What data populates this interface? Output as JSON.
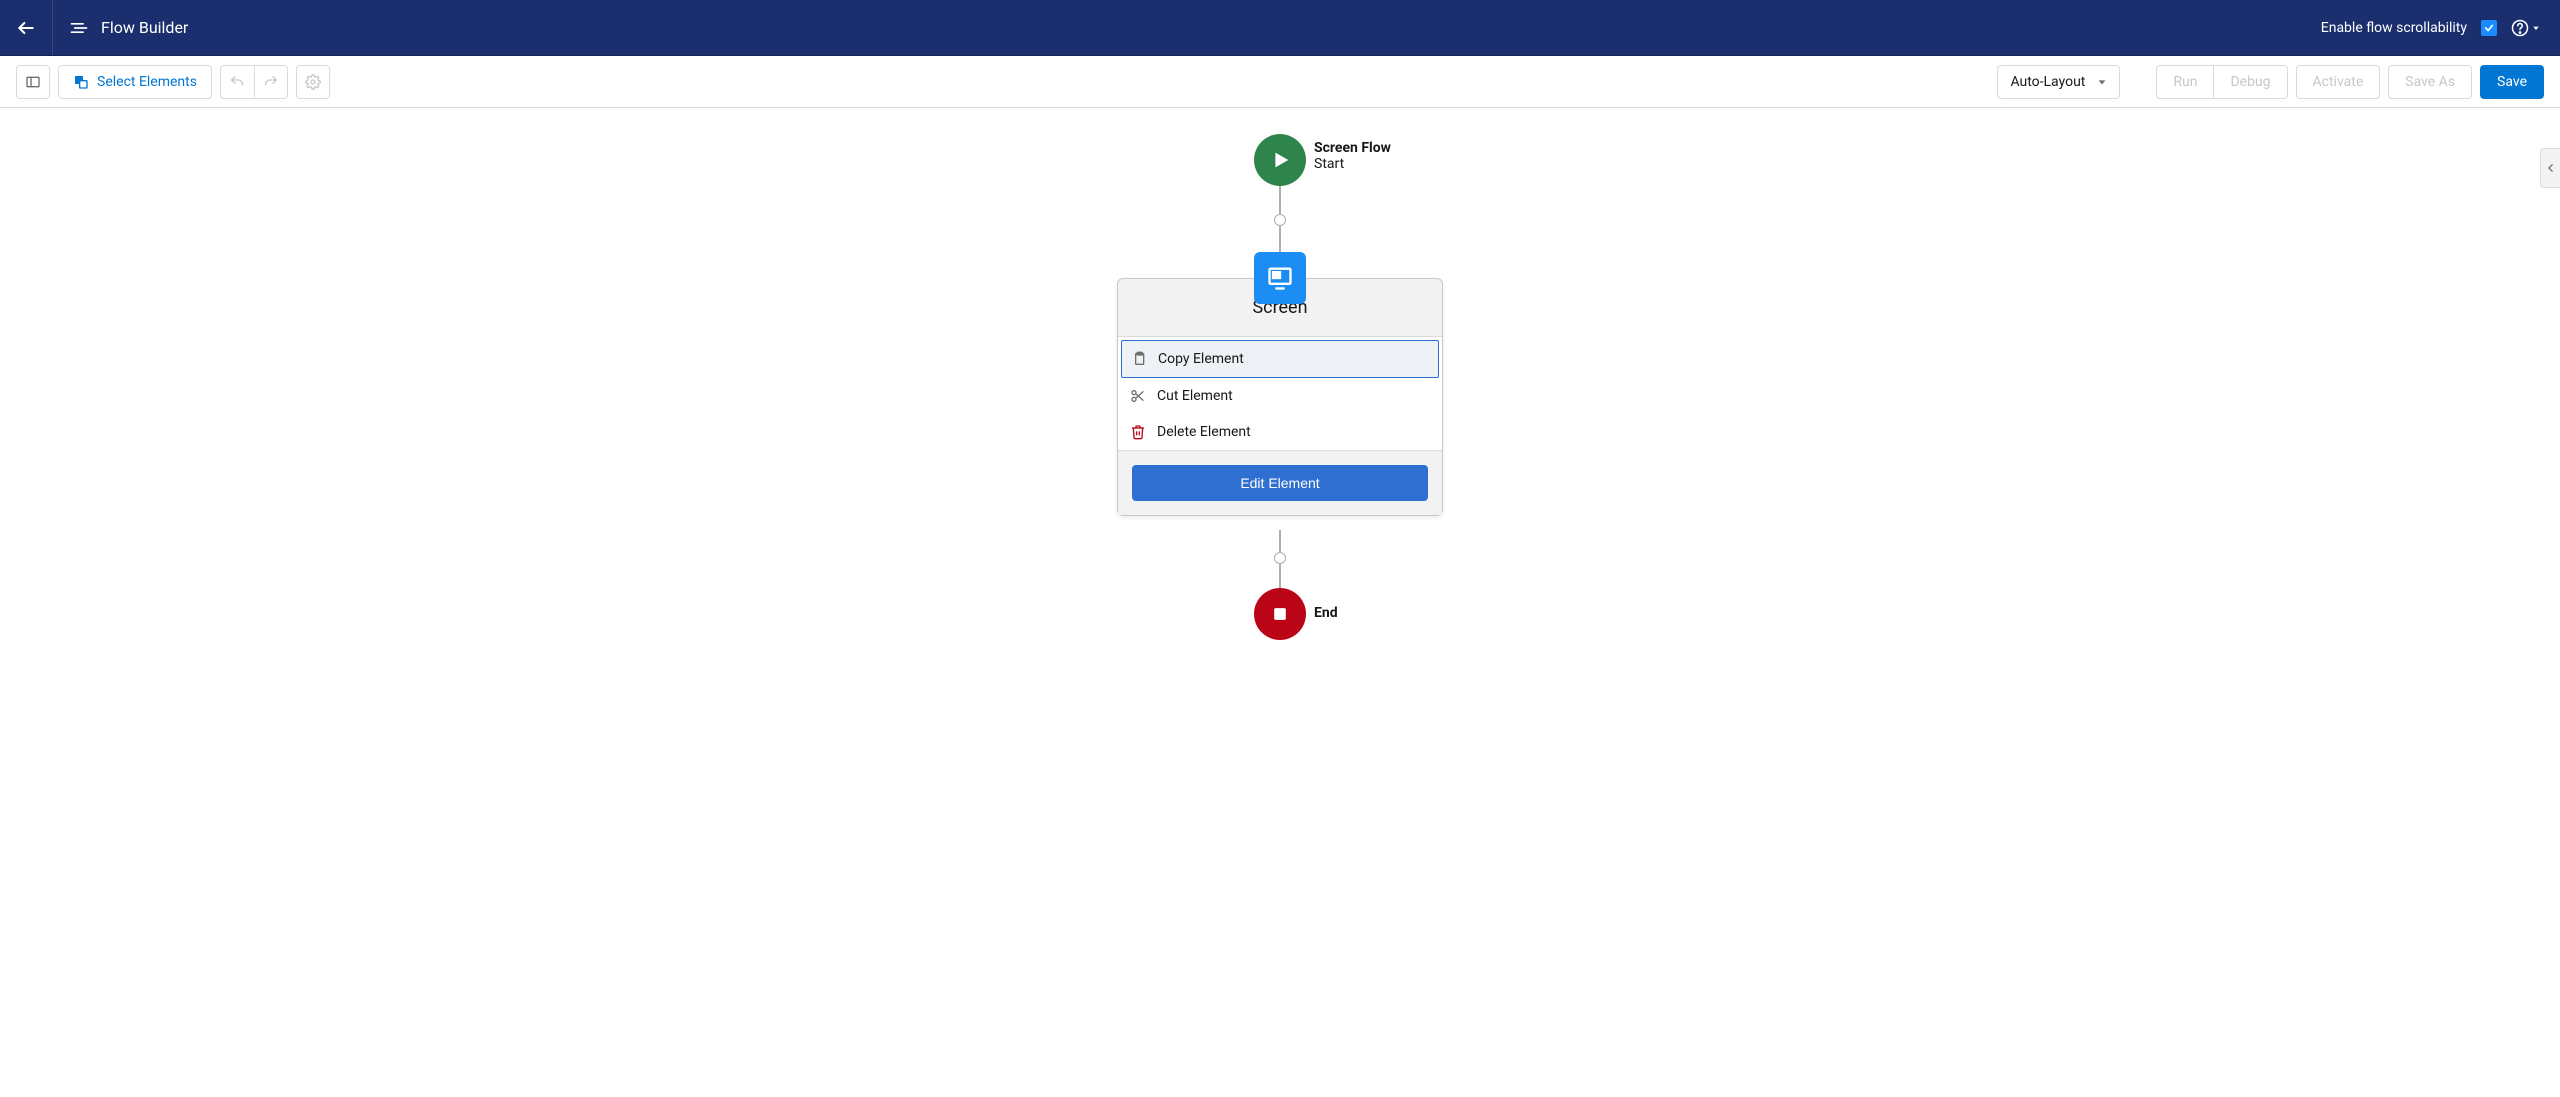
{
  "header": {
    "app_name": "Flow Builder",
    "scrollability_label": "Enable flow scrollability",
    "scrollability_checked": true
  },
  "toolbar": {
    "select_elements_label": "Select Elements",
    "layout_mode": "Auto-Layout",
    "run_label": "Run",
    "debug_label": "Debug",
    "activate_label": "Activate",
    "save_as_label": "Save As",
    "save_label": "Save"
  },
  "nodes": {
    "start": {
      "type": "Screen Flow",
      "subtitle": "Start"
    },
    "screen": {
      "title": "Screen"
    },
    "end": {
      "title": "End"
    }
  },
  "menu": {
    "copy": "Copy Element",
    "cut": "Cut Element",
    "delete": "Delete Element",
    "edit": "Edit Element"
  }
}
